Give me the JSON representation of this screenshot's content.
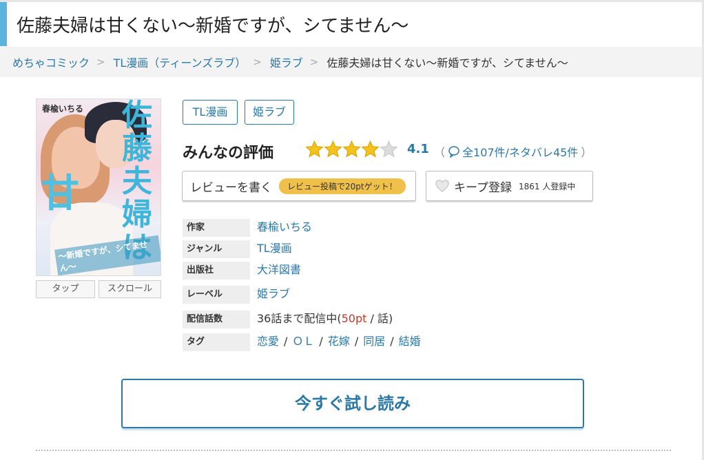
{
  "page_title": "佐藤夫婦は甘くない〜新婚ですが、シてません〜",
  "breadcrumb": {
    "items": [
      "めちゃコミック",
      "TL漫画（ティーンズラブ）",
      "姫ラブ"
    ],
    "current": "佐藤夫婦は甘くない〜新婚ですが、シてません〜"
  },
  "cover": {
    "author": "春楡いちる",
    "title_vertical": "佐藤夫婦は",
    "title_big": "甘",
    "subtitle": "〜新婚ですが、シてません〜",
    "tap_label": "タップ",
    "scroll_label": "スクロール"
  },
  "tags": [
    "TL漫画",
    "姫ラブ"
  ],
  "rating": {
    "heading": "みんなの評価",
    "value": "4.1",
    "stars_filled": 4,
    "stars_total": 5,
    "count_text": "全107件/ネタバレ45件",
    "open_paren": "（",
    "close_paren": "）"
  },
  "review_button": {
    "label": "レビューを書く",
    "badge": "レビュー投稿で20ptゲット！"
  },
  "keep_button": {
    "label": "キープ登録",
    "count": "1861 人登録中"
  },
  "info": {
    "author_label": "作家",
    "author": "春楡いちる",
    "genre_label": "ジャンル",
    "genre": "TL漫画",
    "publisher_label": "出版社",
    "publisher": "大洋図書",
    "label_label": "レーベル",
    "label": "姫ラブ",
    "episodes_label": "配信話数",
    "episodes_prefix": "36話まで配信中(",
    "episodes_pt": "50pt",
    "episodes_suffix": " / 話)",
    "tags_label": "タグ",
    "tags": [
      "恋愛",
      "ＯＬ",
      "花嫁",
      "同居",
      "結婚"
    ],
    "tag_sep": "/"
  },
  "cta": {
    "label": "今すぐ試し読み"
  },
  "colors": {
    "accent": "#2a78a6",
    "title_bar": "#5bb4dd",
    "star": "#f3c21c",
    "badge": "#efc14a",
    "price": "#c0392b"
  }
}
